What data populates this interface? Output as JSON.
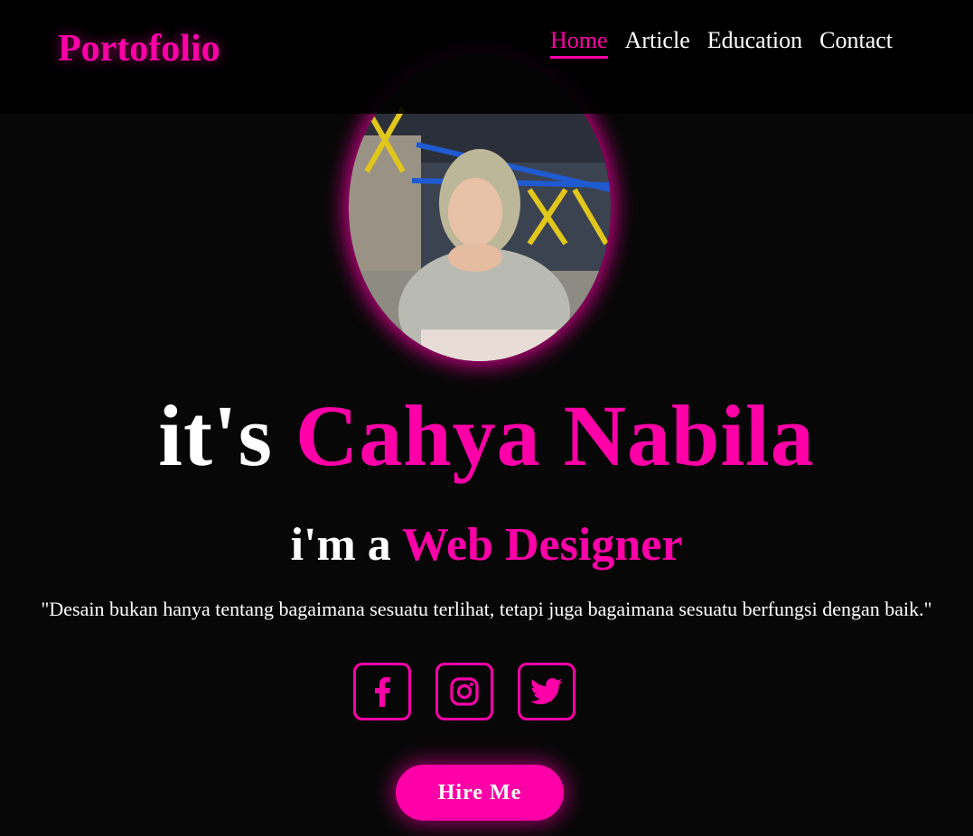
{
  "header": {
    "logo": "Portofolio",
    "nav": [
      {
        "label": "Home",
        "active": true
      },
      {
        "label": "Article",
        "active": false
      },
      {
        "label": "Education",
        "active": false
      },
      {
        "label": "Contact",
        "active": false
      }
    ]
  },
  "hero": {
    "title_prefix": "it's",
    "title_name": "Cahya Nabila",
    "subtitle_prefix": "i'm a",
    "subtitle_role": "Web Designer",
    "quote": "\"Desain bukan hanya tentang bagaimana sesuatu terlihat, tetapi juga bagaimana sesuatu berfungsi dengan baik.\"",
    "hire_label": "Hire Me"
  },
  "socials": [
    {
      "icon": "facebook-icon"
    },
    {
      "icon": "instagram-icon"
    },
    {
      "icon": "twitter-icon"
    }
  ],
  "colors": {
    "accent": "#ff00a8",
    "background": "#070707",
    "text": "#ffffff"
  }
}
